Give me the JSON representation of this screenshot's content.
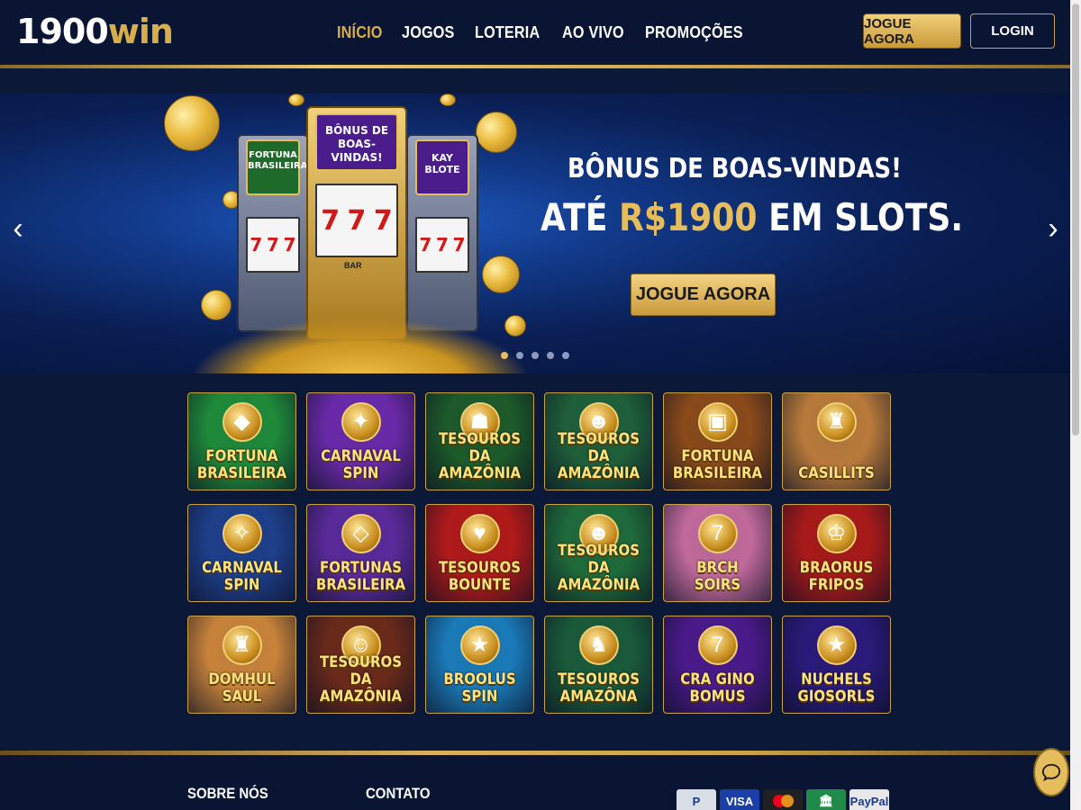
{
  "header": {
    "logo_number": "1900",
    "logo_suffix": "win",
    "nav": [
      {
        "label": "INÍCIO",
        "active": true
      },
      {
        "label": "JOGOS",
        "active": false
      },
      {
        "label": "LOTERIA",
        "active": false
      },
      {
        "label": "AO VIVO",
        "active": false
      },
      {
        "label": "PROMOÇÕES",
        "active": false
      }
    ],
    "play_button": "JOGUE AGORA",
    "login_button": "LOGIN"
  },
  "hero": {
    "title": "BÔNUS DE BOAS-VINDAS!",
    "subtitle_pre": "ATÉ ",
    "subtitle_amount": "R$1900",
    "subtitle_post": " EM SLOTS.",
    "cta": "JOGUE AGORA",
    "prev_icon": "chevron-left-icon",
    "next_icon": "chevron-right-icon",
    "slide_count": 5,
    "active_slide": 0,
    "machine_center_screen": "BÔNUS DE BOAS-VINDAS!",
    "machine_left_screen": "FORTUNA BRASILEIRA",
    "machine_right_screen": "KAY BLOTE",
    "reel_symbols": [
      "7",
      "7",
      "7"
    ],
    "bar_label": "BAR"
  },
  "games": [
    {
      "line1": "FORTUNA",
      "line2": "BRASILEIRA",
      "icon": "brazil-flag-icon",
      "bg": "#1f8a3a"
    },
    {
      "line1": "CARNAVAL",
      "line2": "SPIN",
      "icon": "carnival-mask-icon",
      "bg": "#6a2aa8"
    },
    {
      "line1": "TESOUROS DA",
      "line2": "AMAZÔNIA",
      "icon": "golden-idol-icon",
      "bg": "#1d5a2a"
    },
    {
      "line1": "TESOUROS",
      "line2": "DA AMAZÔNIA",
      "icon": "tribal-mask-icon",
      "bg": "#1f5f3a"
    },
    {
      "line1": "FORTUNA",
      "line2": "BRASILEIRA",
      "icon": "treasure-chest-icon",
      "bg": "#8a4a1a"
    },
    {
      "line1": "CASILLITS",
      "line2": "",
      "icon": "cowboy-icon",
      "bg": "#b87a3a"
    },
    {
      "line1": "CARNAVAL",
      "line2": "SPIN",
      "icon": "feather-mask-icon",
      "bg": "#1e3f8a"
    },
    {
      "line1": "FORTUNAS",
      "line2": "BRASILEIRA",
      "icon": "diamond-icon",
      "bg": "#5a2a9a"
    },
    {
      "line1": "TESOUROS",
      "line2": "BOUNTE",
      "icon": "heart-coin-icon",
      "bg": "#b01a1a"
    },
    {
      "line1": "TESOUROS",
      "line2": "DA AMAZÔNIA",
      "icon": "tribal-mask-icon",
      "bg": "#1f6a3a"
    },
    {
      "line1": "BRCH SOIRS",
      "line2": "",
      "icon": "lucky-seven-icon",
      "bg": "#c06a9a"
    },
    {
      "line1": "BRAORUS",
      "line2": "FRIPOS",
      "icon": "king-icon",
      "bg": "#a81a1a"
    },
    {
      "line1": "DOMHUL",
      "line2": "SAUL",
      "icon": "cowboy-icon",
      "bg": "#c8833a"
    },
    {
      "line1": "TESOUROS",
      "line2": "DA AMAZÔNIA",
      "icon": "explorer-icon",
      "bg": "#6a2a1a"
    },
    {
      "line1": "BROOLUS",
      "line2": "SPIN",
      "icon": "star-icon",
      "bg": "#1a7ab8"
    },
    {
      "line1": "TESOUROS",
      "line2": "AMAZÔNA",
      "icon": "jaguar-icon",
      "bg": "#1a5a3a"
    },
    {
      "line1": "CRA GINO",
      "line2": "BOMUS",
      "icon": "lucky-seven-icon",
      "bg": "#4a1a8a"
    },
    {
      "line1": "NUCHELS GIOSORLS",
      "line2": "",
      "icon": "star-icon",
      "bg": "#2a1a7a"
    }
  ],
  "footer": {
    "about": "SOBRE NÓS",
    "contact": "CONTATO",
    "payments": [
      {
        "label": "P",
        "name": "paypal-p-icon",
        "bg": "#d8dde6",
        "fg": "#1a3a8a"
      },
      {
        "label": "VISA",
        "name": "visa-icon",
        "bg": "#1a3fa8",
        "fg": "#ffffff"
      },
      {
        "label": "",
        "name": "mastercard-icon",
        "bg": "#202020",
        "fg": "#ffffff"
      },
      {
        "label": "🏛",
        "name": "bank-icon",
        "bg": "#1f8a4a",
        "fg": "#ffffff"
      },
      {
        "label": "PayPal",
        "name": "paypal-icon",
        "bg": "#e8e8e8",
        "fg": "#1a3a8a"
      }
    ],
    "chat_icon": "chat-bubble-icon"
  }
}
